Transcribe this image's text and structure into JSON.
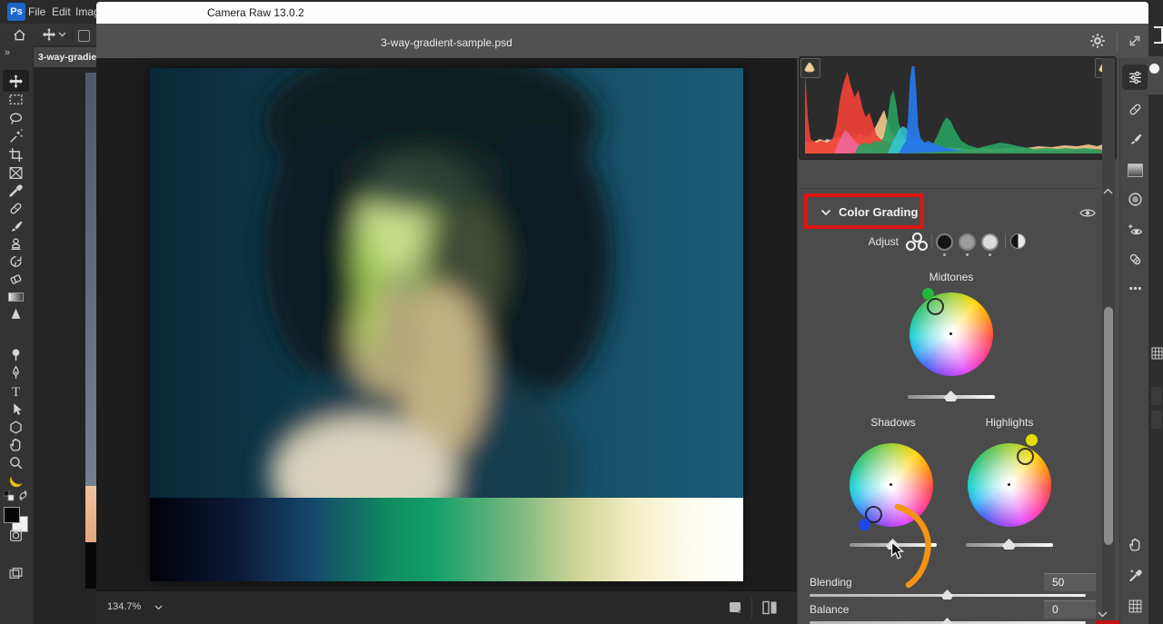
{
  "app": {
    "logo": "Ps",
    "menu_items": [
      "File",
      "Edit",
      "Imag"
    ],
    "toolbar_collapse": "»",
    "document_tab": "3-way-gradien",
    "tools_left": [
      "move",
      "marquee",
      "lasso",
      "magic-wand",
      "crop",
      "frame",
      "eyedropper",
      "spot-healing",
      "brush",
      "clone-stamp",
      "history-brush",
      "eraser",
      "gradient",
      "blur",
      "dodge",
      "pen",
      "type",
      "path-select",
      "shape",
      "hand",
      "zoom",
      "banana",
      "swap-colors",
      "foreground-background",
      "quick-mask",
      "screen-mode"
    ]
  },
  "dialog": {
    "title": "Camera Raw 13.0.2",
    "filename": "3-way-gradient-sample.psd",
    "zoom_level": "134.7%",
    "tools_right": [
      "edit",
      "healing",
      "masking-brush",
      "graduated-filter",
      "radial-filter",
      "red-eye",
      "presets",
      "more-options",
      "hand",
      "white-balance-eyedropper",
      "toggle-grid"
    ]
  },
  "panel": {
    "histogram": {
      "channels": [
        "gray",
        "orange",
        "red",
        "pink",
        "green",
        "cyan",
        "blue"
      ],
      "clipping_indicator_left": true,
      "clipping_indicator_right": true
    },
    "section": {
      "title": "Color Grading"
    },
    "adjust": {
      "label": "Adjust",
      "modes": [
        "three-way",
        "shadows",
        "midtones",
        "highlights",
        "global"
      ]
    },
    "wheels": [
      {
        "label": "Midtones",
        "marker_color": "#25b53a"
      },
      {
        "label": "Shadows",
        "marker_color": "#1d49e8"
      },
      {
        "label": "Highlights",
        "marker_color": "#e3de0a"
      }
    ],
    "sliders": [
      {
        "label": "Blending",
        "value": "50"
      },
      {
        "label": "Balance",
        "value": "0"
      }
    ]
  },
  "annotations": {
    "highlight_color": "#e11414",
    "arrow_color": "#f39412"
  }
}
